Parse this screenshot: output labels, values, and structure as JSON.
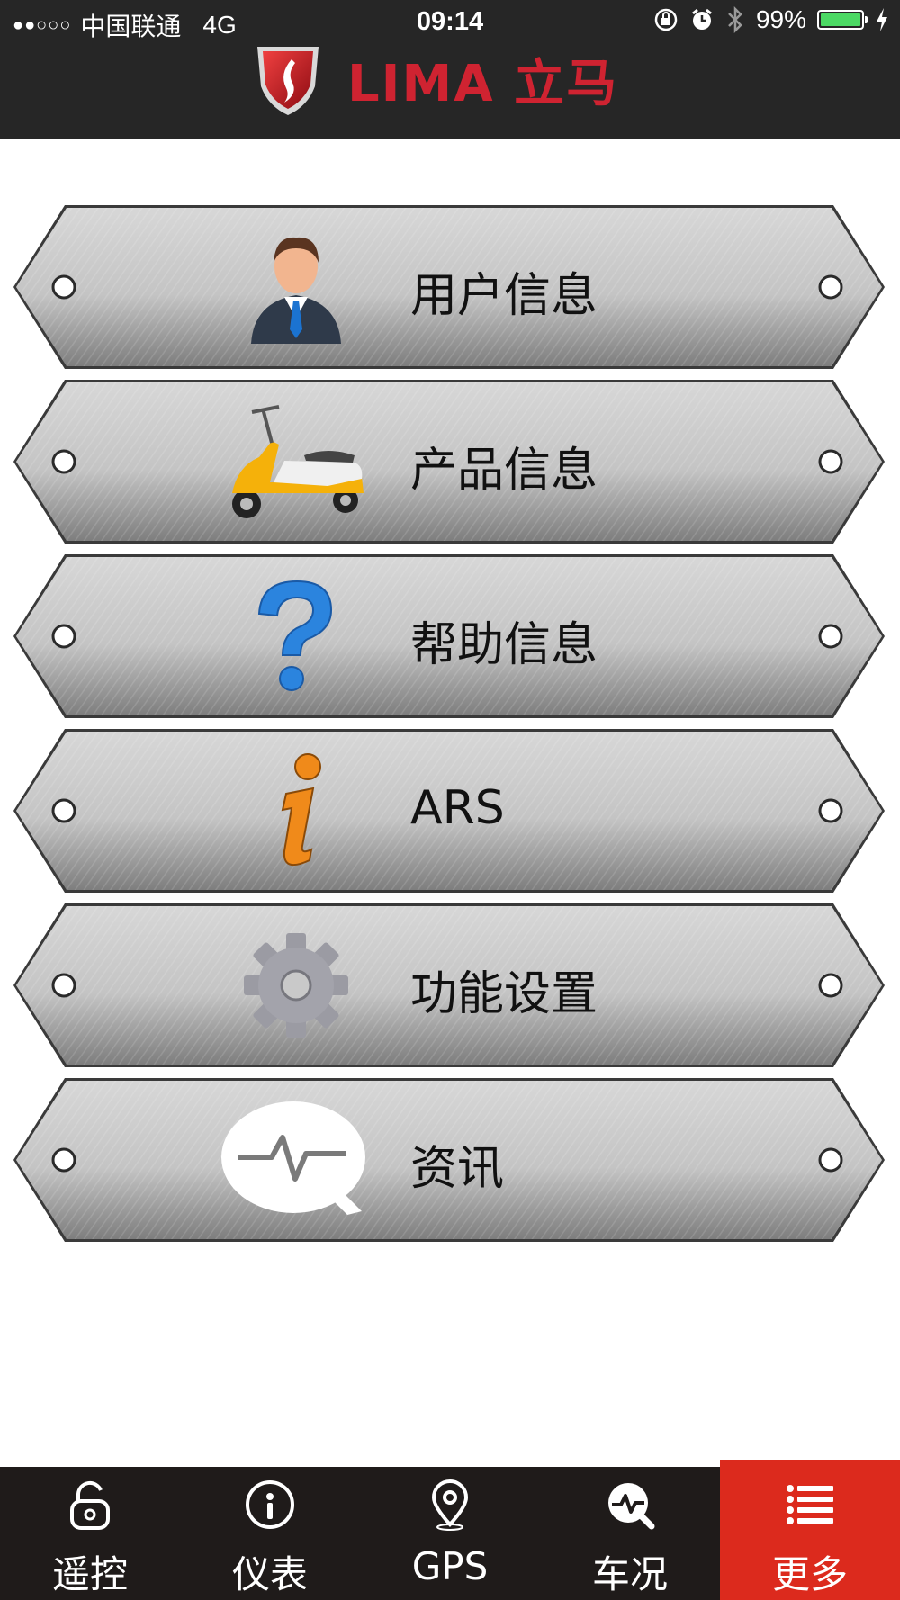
{
  "status_bar": {
    "signal": "●●○○○",
    "carrier": "中国联通",
    "network": "4G",
    "time": "09:14",
    "battery_text": "99%",
    "battery_level": 0.99
  },
  "header": {
    "brand_text": "LIMA 立马"
  },
  "menu": {
    "items": [
      {
        "label": "用户信息",
        "icon": "user-icon"
      },
      {
        "label": "产品信息",
        "icon": "scooter-icon"
      },
      {
        "label": "帮助信息",
        "icon": "help-icon"
      },
      {
        "label": "ARS",
        "icon": "info-icon"
      },
      {
        "label": "功能设置",
        "icon": "gear-icon"
      },
      {
        "label": "资讯",
        "icon": "news-icon"
      }
    ]
  },
  "tabbar": {
    "items": [
      {
        "label": "遥控",
        "icon": "unlock-icon"
      },
      {
        "label": "仪表",
        "icon": "gauge-icon"
      },
      {
        "label": "GPS",
        "icon": "location-pin-icon"
      },
      {
        "label": "车况",
        "icon": "vehicle-status-icon"
      },
      {
        "label": "更多",
        "icon": "list-icon"
      }
    ],
    "active_index": 4,
    "active_color": "#dc2a1d"
  }
}
